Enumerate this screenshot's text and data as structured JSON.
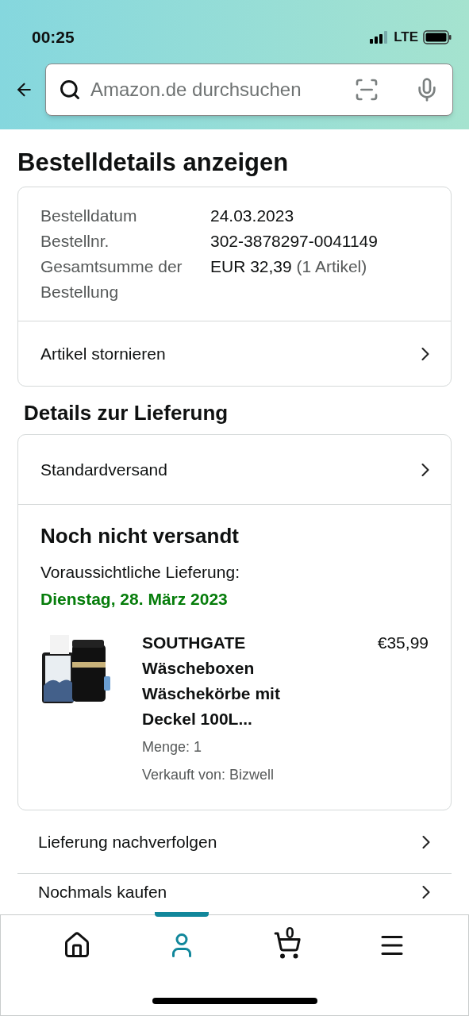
{
  "status_bar": {
    "time": "00:25",
    "network": "LTE"
  },
  "search": {
    "placeholder": "Amazon.de durchsuchen"
  },
  "title": "Bestelldetails anzeigen",
  "order": {
    "fields": [
      {
        "label": "Bestelldatum",
        "value": "24.03.2023"
      },
      {
        "label": "Bestellnr.",
        "value": "302-3878297-0041149"
      },
      {
        "label": "Gesamtsumme der Bestellung",
        "value": "EUR 32,39",
        "note": "(1 Artikel)"
      }
    ],
    "action": "Artikel stornieren"
  },
  "delivery": {
    "heading": "Details zur Lieferung",
    "shipping": "Standardversand",
    "status": "Noch nicht versandt",
    "expected_label": "Voraussichtliche Lieferung:",
    "expected_date": "Dienstag, 28. März 2023",
    "item": {
      "title": "SOUTHGATE Wäscheboxen Wäschekörbe mit Deckel 100L...",
      "price": "€35,99",
      "quantity": "Menge: 1",
      "seller": "Verkauft von: Bizwell"
    }
  },
  "links": [
    "Lieferung nachverfolgen",
    "Nochmals kaufen"
  ],
  "tabs": [
    {
      "kind": "home",
      "selected": false
    },
    {
      "kind": "account",
      "selected": true
    },
    {
      "kind": "cart",
      "selected": false,
      "count": "0"
    },
    {
      "kind": "menu",
      "selected": false
    }
  ]
}
